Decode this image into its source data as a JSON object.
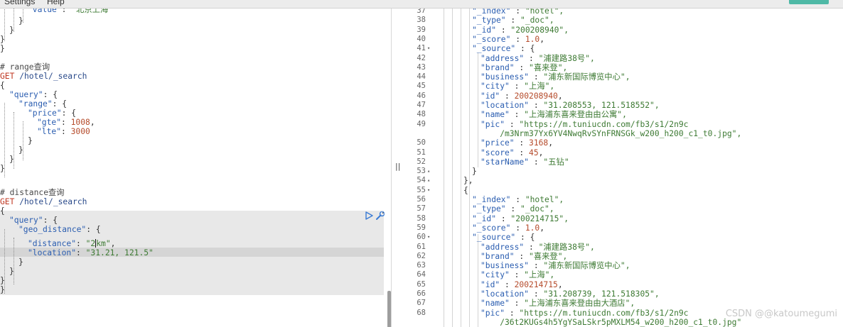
{
  "menubar": {
    "settings": "Settings",
    "help": "Help"
  },
  "editor": {
    "lines": [
      [
        {
          "c": "t-key",
          "t": "\"value\""
        },
        {
          "c": "t-brace",
          "t": ": "
        },
        {
          "c": "t-str",
          "t": "\"北京上海\""
        }
      ],
      [
        {
          "c": "t-brace",
          "t": "}"
        }
      ],
      [
        {
          "c": "t-brace",
          "t": "}"
        }
      ],
      [
        {
          "c": "t-brace",
          "t": "}"
        }
      ],
      [
        {
          "c": "t-brace",
          "t": "}"
        }
      ],
      [],
      [
        {
          "c": "t-comment",
          "t": "# range查询"
        }
      ],
      [
        {
          "c": "t-method",
          "t": "GET"
        },
        {
          "c": "t-url",
          "t": " /hotel/_search"
        }
      ],
      [
        {
          "c": "t-brace",
          "t": "{"
        }
      ],
      [
        {
          "c": "t-key",
          "t": "\"query\""
        },
        {
          "c": "t-brace",
          "t": ": {"
        }
      ],
      [
        {
          "c": "t-key",
          "t": "\"range\""
        },
        {
          "c": "t-brace",
          "t": ": {"
        }
      ],
      [
        {
          "c": "t-key",
          "t": "\"price\""
        },
        {
          "c": "t-brace",
          "t": ": {"
        }
      ],
      [
        {
          "c": "t-key",
          "t": "\"gte\""
        },
        {
          "c": "t-brace",
          "t": ": "
        },
        {
          "c": "t-num",
          "t": "1008"
        },
        {
          "c": "t-brace",
          "t": ","
        }
      ],
      [
        {
          "c": "t-key",
          "t": "\"lte\""
        },
        {
          "c": "t-brace",
          "t": ": "
        },
        {
          "c": "t-num",
          "t": "3000"
        }
      ],
      [
        {
          "c": "t-brace",
          "t": "}"
        }
      ],
      [
        {
          "c": "t-brace",
          "t": "}"
        }
      ],
      [
        {
          "c": "t-brace",
          "t": "}"
        }
      ],
      [
        {
          "c": "t-brace",
          "t": "}"
        }
      ],
      [],
      [
        {
          "c": "t-comment",
          "t": "# distance查询"
        }
      ],
      [
        {
          "c": "t-method",
          "t": "GET"
        },
        {
          "c": "t-url",
          "t": " /hotel/_search"
        }
      ],
      [
        {
          "c": "t-brace",
          "t": "{"
        }
      ],
      [
        {
          "c": "t-key",
          "t": "\"query\""
        },
        {
          "c": "t-brace",
          "t": ": {"
        }
      ],
      [
        {
          "c": "t-key",
          "t": "\"geo_distance\""
        },
        {
          "c": "t-brace",
          "t": ": {"
        }
      ],
      [
        {
          "c": "t-key",
          "t": "\"distance\""
        },
        {
          "c": "t-brace",
          "t": ": "
        },
        {
          "c": "t-str",
          "t": "\"2"
        },
        {
          "c": "caret",
          "t": ""
        },
        {
          "c": "t-str",
          "t": "km\""
        },
        {
          "c": "t-brace",
          "t": ","
        }
      ],
      [
        {
          "c": "t-key",
          "t": "\"location\""
        },
        {
          "c": "t-brace",
          "t": ": "
        },
        {
          "c": "t-str",
          "t": "\"31.21, 121.5\""
        }
      ],
      [
        {
          "c": "t-brace",
          "t": "}"
        }
      ],
      [
        {
          "c": "t-brace",
          "t": "}"
        }
      ],
      [
        {
          "c": "t-brace",
          "t": "}"
        }
      ],
      [
        {
          "c": "t-brace",
          "t": "}"
        }
      ]
    ]
  },
  "output": {
    "line_numbers": [
      "37",
      "38",
      "39",
      "40",
      "41",
      "42",
      "43",
      "44",
      "45",
      "46",
      "47",
      "48",
      "49",
      "",
      "50",
      "51",
      "52",
      "53",
      "54",
      "55",
      "56",
      "57",
      "58",
      "59",
      "60",
      "61",
      "62",
      "63",
      "64",
      "65",
      "66",
      "67",
      "68",
      ""
    ],
    "lines": [
      [
        {
          "c": "t-key",
          "t": "\"_index\""
        },
        {
          "c": "t-brace",
          "t": " : "
        },
        {
          "c": "t-str",
          "t": "\"hotel\","
        }
      ],
      [
        {
          "c": "t-key",
          "t": "\"_type\""
        },
        {
          "c": "t-brace",
          "t": " : "
        },
        {
          "c": "t-str",
          "t": "\"_doc\","
        }
      ],
      [
        {
          "c": "t-key",
          "t": "\"_id\""
        },
        {
          "c": "t-brace",
          "t": " : "
        },
        {
          "c": "t-str",
          "t": "\"200208940\","
        }
      ],
      [
        {
          "c": "t-key",
          "t": "\"_score\""
        },
        {
          "c": "t-brace",
          "t": " : "
        },
        {
          "c": "t-num",
          "t": "1.0"
        },
        {
          "c": "t-brace",
          "t": ","
        }
      ],
      [
        {
          "c": "t-key",
          "t": "\"_source\""
        },
        {
          "c": "t-brace",
          "t": " : {"
        }
      ],
      [
        {
          "c": "t-key",
          "t": "\"address\""
        },
        {
          "c": "t-brace",
          "t": " : "
        },
        {
          "c": "t-str",
          "t": "\"浦建路38号\","
        }
      ],
      [
        {
          "c": "t-key",
          "t": "\"brand\""
        },
        {
          "c": "t-brace",
          "t": " : "
        },
        {
          "c": "t-str",
          "t": "\"喜来登\","
        }
      ],
      [
        {
          "c": "t-key",
          "t": "\"business\""
        },
        {
          "c": "t-brace",
          "t": " : "
        },
        {
          "c": "t-str",
          "t": "\"浦东新国际博览中心\","
        }
      ],
      [
        {
          "c": "t-key",
          "t": "\"city\""
        },
        {
          "c": "t-brace",
          "t": " : "
        },
        {
          "c": "t-str",
          "t": "\"上海\","
        }
      ],
      [
        {
          "c": "t-key",
          "t": "\"id\""
        },
        {
          "c": "t-brace",
          "t": " : "
        },
        {
          "c": "t-num",
          "t": "200208940"
        },
        {
          "c": "t-brace",
          "t": ","
        }
      ],
      [
        {
          "c": "t-key",
          "t": "\"location\""
        },
        {
          "c": "t-brace",
          "t": " : "
        },
        {
          "c": "t-str",
          "t": "\"31.208553, 121.518552\","
        }
      ],
      [
        {
          "c": "t-key",
          "t": "\"name\""
        },
        {
          "c": "t-brace",
          "t": " : "
        },
        {
          "c": "t-str",
          "t": "\"上海浦东喜来登由由公寓\","
        }
      ],
      [
        {
          "c": "t-key",
          "t": "\"pic\""
        },
        {
          "c": "t-brace",
          "t": " : "
        },
        {
          "c": "t-str",
          "t": "\"https://m.tuniucdn.com/fb3/s1/2n9c"
        }
      ],
      [
        {
          "c": "t-str",
          "t": "    /m3Nrm37Yx6YV4NwqRvSYnFRNSGk_w200_h200_c1_t0.jpg\","
        }
      ],
      [
        {
          "c": "t-key",
          "t": "\"price\""
        },
        {
          "c": "t-brace",
          "t": " : "
        },
        {
          "c": "t-num",
          "t": "3168"
        },
        {
          "c": "t-brace",
          "t": ","
        }
      ],
      [
        {
          "c": "t-key",
          "t": "\"score\""
        },
        {
          "c": "t-brace",
          "t": " : "
        },
        {
          "c": "t-num",
          "t": "45"
        },
        {
          "c": "t-brace",
          "t": ","
        }
      ],
      [
        {
          "c": "t-key",
          "t": "\"starName\""
        },
        {
          "c": "t-brace",
          "t": " : "
        },
        {
          "c": "t-str",
          "t": "\"五钻\""
        }
      ],
      [
        {
          "c": "t-brace",
          "t": "}"
        }
      ],
      [
        {
          "c": "t-brace",
          "t": "},"
        }
      ],
      [
        {
          "c": "t-brace",
          "t": "{"
        }
      ],
      [
        {
          "c": "t-key",
          "t": "\"_index\""
        },
        {
          "c": "t-brace",
          "t": " : "
        },
        {
          "c": "t-str",
          "t": "\"hotel\","
        }
      ],
      [
        {
          "c": "t-key",
          "t": "\"_type\""
        },
        {
          "c": "t-brace",
          "t": " : "
        },
        {
          "c": "t-str",
          "t": "\"_doc\","
        }
      ],
      [
        {
          "c": "t-key",
          "t": "\"_id\""
        },
        {
          "c": "t-brace",
          "t": " : "
        },
        {
          "c": "t-str",
          "t": "\"200214715\","
        }
      ],
      [
        {
          "c": "t-key",
          "t": "\"_score\""
        },
        {
          "c": "t-brace",
          "t": " : "
        },
        {
          "c": "t-num",
          "t": "1.0"
        },
        {
          "c": "t-brace",
          "t": ","
        }
      ],
      [
        {
          "c": "t-key",
          "t": "\"_source\""
        },
        {
          "c": "t-brace",
          "t": " : {"
        }
      ],
      [
        {
          "c": "t-key",
          "t": "\"address\""
        },
        {
          "c": "t-brace",
          "t": " : "
        },
        {
          "c": "t-str",
          "t": "\"浦建路38号\","
        }
      ],
      [
        {
          "c": "t-key",
          "t": "\"brand\""
        },
        {
          "c": "t-brace",
          "t": " : "
        },
        {
          "c": "t-str",
          "t": "\"喜来登\","
        }
      ],
      [
        {
          "c": "t-key",
          "t": "\"business\""
        },
        {
          "c": "t-brace",
          "t": " : "
        },
        {
          "c": "t-str",
          "t": "\"浦东新国际博览中心\","
        }
      ],
      [
        {
          "c": "t-key",
          "t": "\"city\""
        },
        {
          "c": "t-brace",
          "t": " : "
        },
        {
          "c": "t-str",
          "t": "\"上海\","
        }
      ],
      [
        {
          "c": "t-key",
          "t": "\"id\""
        },
        {
          "c": "t-brace",
          "t": " : "
        },
        {
          "c": "t-num",
          "t": "200214715"
        },
        {
          "c": "t-brace",
          "t": ","
        }
      ],
      [
        {
          "c": "t-key",
          "t": "\"location\""
        },
        {
          "c": "t-brace",
          "t": " : "
        },
        {
          "c": "t-str",
          "t": "\"31.208739, 121.518305\","
        }
      ],
      [
        {
          "c": "t-key",
          "t": "\"name\""
        },
        {
          "c": "t-brace",
          "t": " : "
        },
        {
          "c": "t-str",
          "t": "\"上海浦东喜来登由由大酒店\","
        }
      ],
      [
        {
          "c": "t-key",
          "t": "\"pic\""
        },
        {
          "c": "t-brace",
          "t": " : "
        },
        {
          "c": "t-str",
          "t": "\"https://m.tuniucdn.com/fb3/s1/2n9c"
        }
      ],
      [
        {
          "c": "t-str",
          "t": "    /36t2KUGs4h5YgYSaLSkr5pMXLM54_w200_h200_c1_t0.jpg\""
        }
      ]
    ]
  },
  "watermark": "CSDN @@katoumegumi"
}
